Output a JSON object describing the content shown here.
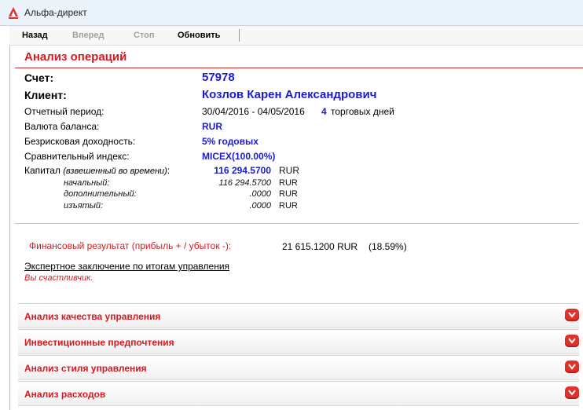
{
  "window": {
    "title": "Альфа-директ"
  },
  "toolbar": {
    "back": "Назад",
    "forward": "Вперед",
    "stop": "Стоп",
    "refresh": "Обновить"
  },
  "report": {
    "title": "Анализ операций",
    "account_label": "Счет:",
    "account_value": "57978",
    "client_label": "Клиент:",
    "client_value": "Козлов Карен Александрович",
    "period_label": "Отчетный период:",
    "period_value": "30/04/2016 - 04/05/2016",
    "trading_days_count": "4",
    "trading_days_label": "торговых дней",
    "currency_label": "Валюта баланса:",
    "currency_value": "RUR",
    "riskfree_label": "Безрисковая доходность:",
    "riskfree_value": "5% годовых",
    "index_label": "Сравнительный индекс:",
    "index_value": "MICEX(100.00%)",
    "capital": {
      "label": "Капитал",
      "label_note": "(взвешенный во времени)",
      "colon": ":",
      "value": "116 294.5700",
      "currency": "RUR",
      "rows": [
        {
          "label": "начальный:",
          "value": "116 294.5700",
          "currency": "RUR"
        },
        {
          "label": "дополнительный:",
          "value": ".0000",
          "currency": "RUR"
        },
        {
          "label": "изъятый:",
          "value": ".0000",
          "currency": "RUR"
        }
      ]
    },
    "financial_result_label": "Финансовый результат (прибыль + / убыток -):",
    "financial_result_value": "21 615.1200 RUR",
    "financial_result_percent": "(18.59%)",
    "expert_label": "Экспертное заключение по итогам управления",
    "expert_text": "Вы счастливчик."
  },
  "sections": [
    {
      "label": "Анализ качества управления"
    },
    {
      "label": "Инвестиционные предпочтения"
    },
    {
      "label": "Анализ стиля управления"
    },
    {
      "label": "Анализ расходов"
    }
  ],
  "colors": {
    "accent": "#d71921",
    "value_blue": "#1a1ad6"
  },
  "icons": {
    "logo": "alfa-logo-icon",
    "expand": "chevron-down-icon"
  }
}
